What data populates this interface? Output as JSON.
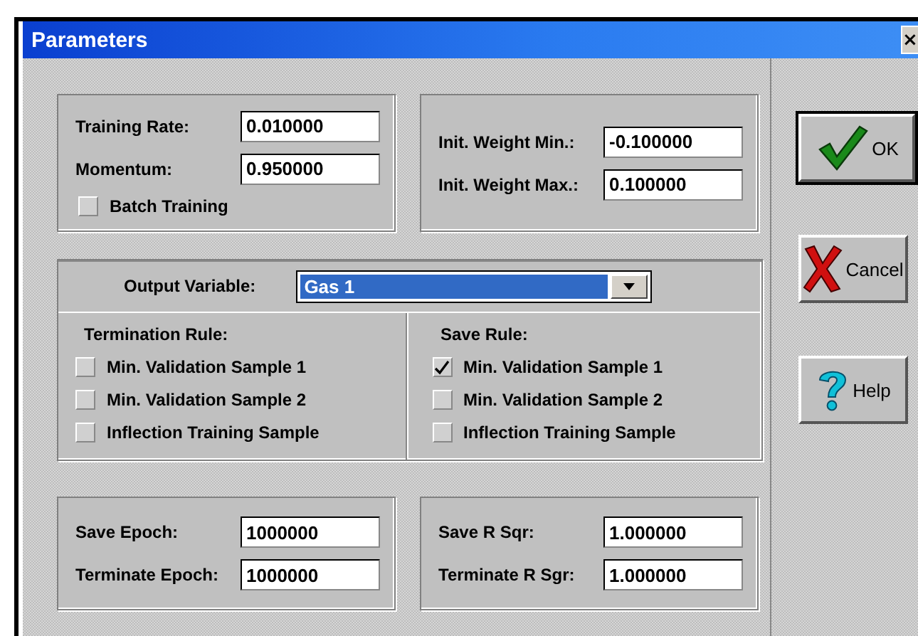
{
  "window": {
    "title": "Parameters",
    "close": "×"
  },
  "training": {
    "fields": [
      {
        "label": "Training Rate:",
        "value": "0.010000"
      },
      {
        "label": "Momentum:",
        "value": "0.950000"
      }
    ],
    "batch_training": {
      "label": "Batch Training",
      "checked": false
    }
  },
  "init_weights": [
    {
      "label": "Init. Weight Min.:",
      "value": "-0.100000"
    },
    {
      "label": "Init. Weight Max.:",
      "value": "0.100000"
    }
  ],
  "output_variable": {
    "label": "Output Variable:",
    "value": "Gas 1"
  },
  "rules": [
    {
      "title": "Termination Rule:",
      "options": [
        {
          "label": "Min. Validation Sample 1",
          "checked": false
        },
        {
          "label": "Min. Validation Sample 2",
          "checked": false
        },
        {
          "label": "Inflection Training Sample",
          "checked": false
        }
      ]
    },
    {
      "title": "Save Rule:",
      "options": [
        {
          "label": "Min. Validation Sample 1",
          "checked": true
        },
        {
          "label": "Min. Validation Sample 2",
          "checked": false
        },
        {
          "label": "Inflection Training Sample",
          "checked": false
        }
      ]
    }
  ],
  "epochs": [
    {
      "label": "Save Epoch:",
      "value": "1000000"
    },
    {
      "label": "Terminate Epoch:",
      "value": "1000000"
    }
  ],
  "r_sqr": [
    {
      "label": "Save R Sqr:",
      "value": "1.000000"
    },
    {
      "label": "Terminate R Sgr:",
      "value": "1.000000"
    }
  ],
  "buttons": [
    {
      "label": "OK",
      "kind": "ok"
    },
    {
      "label": "Cancel",
      "kind": "cancel"
    },
    {
      "label": "Help",
      "kind": "help"
    }
  ]
}
